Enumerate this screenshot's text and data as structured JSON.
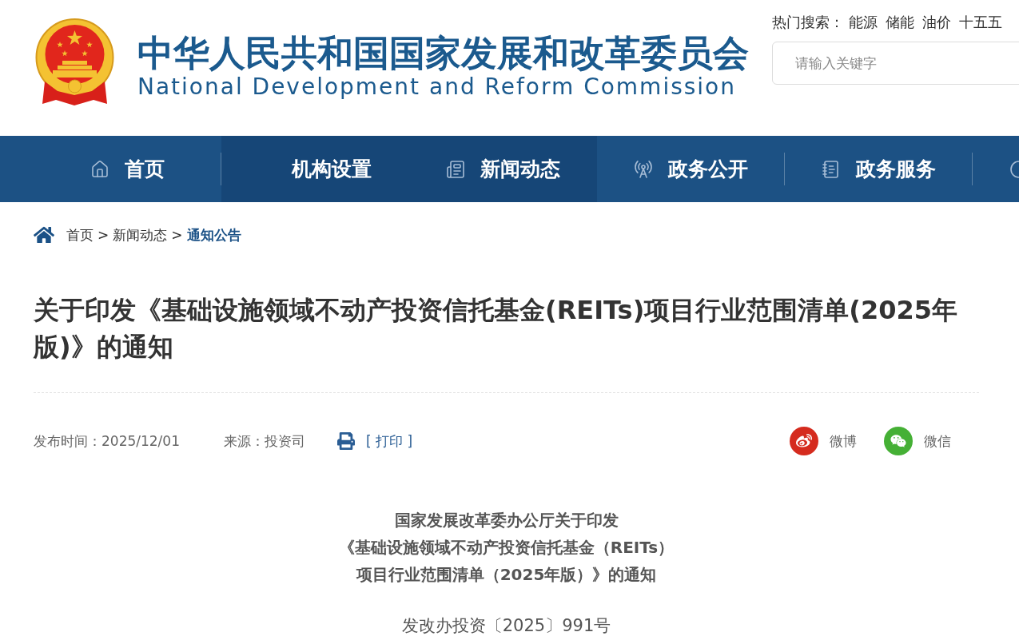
{
  "header": {
    "title_zh": "中华人民共和国国家发展和改革委员会",
    "title_en": "National Development and Reform Commission",
    "hot_search": {
      "label": "热门搜索：",
      "terms": [
        "能源",
        "储能",
        "油价",
        "十五五"
      ]
    },
    "search": {
      "placeholder": "请输入关键字"
    }
  },
  "nav": [
    {
      "kind": "home",
      "label": "首页",
      "highlighted": false
    },
    {
      "kind": "blank",
      "label": "机构设置",
      "highlighted": true
    },
    {
      "kind": "news",
      "label": "新闻动态",
      "highlighted": true
    },
    {
      "kind": "signal",
      "label": "政务公开",
      "highlighted": false
    },
    {
      "kind": "book",
      "label": "政务服务",
      "highlighted": false
    },
    {
      "kind": "circle",
      "highlighted": false
    }
  ],
  "breadcrumb": [
    {
      "kind": "link",
      "label": "首页"
    },
    {
      "kind": "separator",
      "label": ">"
    },
    {
      "kind": "link",
      "label": "新闻动态"
    },
    {
      "kind": "separator",
      "label": ">"
    },
    {
      "kind": "current",
      "label": "通知公告"
    }
  ],
  "article": {
    "title": "关于印发《基础设施领域不动产投资信托基金(REITs)项目行业范围清单(2025年版)》的通知",
    "meta": {
      "date": "发布时间：2025/12/01",
      "source": "来源：投资司",
      "print": "[ 打印 ]"
    },
    "share": [
      {
        "kind": "weibo",
        "label": "微博"
      },
      {
        "kind": "wechat",
        "label": "微信"
      }
    ],
    "doc_title_lines": [
      "国家发展改革委办公厅关于印发",
      "《基础设施领域不动产投资信托基金（REITs）",
      "项目行业范围清单（2025年版）》的通知"
    ],
    "doc_number": "发改办投资〔2025〕991号"
  }
}
